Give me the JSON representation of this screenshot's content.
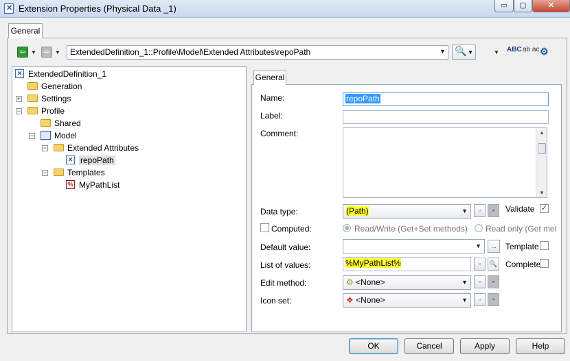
{
  "window": {
    "title": "Extension Properties (Physical Data _1)",
    "min_glyph": "▭",
    "max_glyph": "▢",
    "close_glyph": "✕"
  },
  "outer_tab": {
    "label": "General"
  },
  "toolbar": {
    "path": "ExtendedDefinition_1::Profile\\Model\\Extended Attributes\\repoPath",
    "back_glyph": "⇦",
    "forward_glyph": "⇨",
    "find_glyph": "🔍",
    "spell_check_label": "ABC",
    "replace_label": "ab ac",
    "properties_glyph": "⚙"
  },
  "tree": {
    "items": [
      {
        "label": "ExtendedDefinition_1",
        "icon": "extension-icon"
      },
      {
        "label": "Generation",
        "icon": "folder-icon"
      },
      {
        "label": "Settings",
        "icon": "folder-icon"
      },
      {
        "label": "Profile",
        "icon": "folder-icon"
      },
      {
        "label": "Shared",
        "icon": "folder-icon"
      },
      {
        "label": "Model",
        "icon": "model-icon"
      },
      {
        "label": "Extended Attributes",
        "icon": "folder-icon"
      },
      {
        "label": "repoPath",
        "icon": "extended-attribute-icon"
      },
      {
        "label": "Templates",
        "icon": "folder-icon"
      },
      {
        "label": "MyPathList",
        "icon": "template-icon"
      }
    ]
  },
  "panel": {
    "tab_label": "General",
    "name_label": "Name:",
    "name_value": "repoPath",
    "label_label": "Label:",
    "label_value": "",
    "comment_label": "Comment:",
    "comment_value": "",
    "data_type_label": "Data type:",
    "data_type_value": "(Path)",
    "validate_label": "Validate",
    "validate_checked": true,
    "computed_label": "Computed:",
    "read_write_label": "Read/Write (Get+Set methods)",
    "read_only_label": "Read only (Get metho",
    "default_value_label": "Default value:",
    "default_value": "",
    "ellipsis_label": "...",
    "template_label": "Template",
    "list_of_values_label": "List of values:",
    "list_of_values": "%MyPathList%",
    "complete_label": "Complete",
    "edit_method_label": "Edit method:",
    "edit_method_value": "<None>",
    "icon_set_label": "Icon set:",
    "icon_set_value": "<None>",
    "highlight_color": "#ffff33"
  },
  "buttons": {
    "ok": "OK",
    "cancel": "Cancel",
    "apply": "Apply",
    "help": "Help"
  }
}
